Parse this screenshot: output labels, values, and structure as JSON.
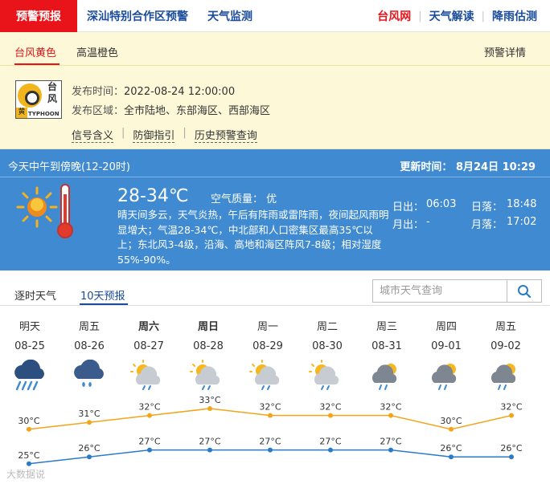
{
  "nav": {
    "active": "预警预报",
    "links": [
      "深汕特别合作区预警",
      "天气监测"
    ],
    "right": [
      "台风网",
      "天气解读",
      "降雨估测"
    ]
  },
  "warning": {
    "tabs": [
      "台风黄色",
      "高温橙色"
    ],
    "detail_link": "预警详情",
    "badge": {
      "title": "台风",
      "level": "黄",
      "en": "TYPHOON"
    },
    "time_label": "发布时间：",
    "time_value": "2022-08-24 12:00:00",
    "area_label": "发布区域：",
    "area_value": "全市陆地、东部海区、西部海区",
    "links": [
      "信号含义",
      "防御指引",
      "历史预警查询"
    ]
  },
  "today": {
    "period": "今天中午到傍晚(12-20时)",
    "update": "更新时间： 8月24日 10:29",
    "temp": "28-34℃",
    "air_quality": "空气质量：  优",
    "description": "晴天间多云，天气炎热，午后有阵雨或雷阵雨，夜间起风雨明显增大；气温28-34℃，中北部和人口密集区最高35℃以上；东北风3-4级，沿海、高地和海区阵风7-8级；相对湿度55%-90%。",
    "sunrise_label": "日出：",
    "sunrise": "06:03",
    "sunset_label": "日落：",
    "sunset": "18:48",
    "moonrise_label": "月出：",
    "moonrise": "-",
    "moonset_label": "月落：",
    "moonset": "17:02"
  },
  "forecast": {
    "tabs": [
      "逐时天气",
      "10天预报"
    ],
    "search_placeholder": "城市天气查询",
    "days": [
      {
        "week": "明天",
        "date": "08-25",
        "icon": "heavy-rain-icon",
        "bold": false
      },
      {
        "week": "周五",
        "date": "08-26",
        "icon": "rain-icon",
        "bold": false
      },
      {
        "week": "周六",
        "date": "08-27",
        "icon": "sun-cloud-rain-icon",
        "bold": true
      },
      {
        "week": "周日",
        "date": "08-28",
        "icon": "sun-cloud-rain-icon",
        "bold": true
      },
      {
        "week": "周一",
        "date": "08-29",
        "icon": "sun-cloud-rain-icon",
        "bold": false
      },
      {
        "week": "周二",
        "date": "08-30",
        "icon": "sun-cloud-rain-icon",
        "bold": false
      },
      {
        "week": "周三",
        "date": "08-31",
        "icon": "sun-cloud-shower-icon",
        "bold": false
      },
      {
        "week": "周四",
        "date": "09-01",
        "icon": "sun-cloud-shower-icon",
        "bold": false
      },
      {
        "week": "周五",
        "date": "09-02",
        "icon": "sun-cloud-shower-icon",
        "bold": false
      }
    ]
  },
  "chart_data": {
    "type": "line",
    "categories": [
      "08-25",
      "08-26",
      "08-27",
      "08-28",
      "08-29",
      "08-30",
      "08-31",
      "09-01",
      "09-02"
    ],
    "series": [
      {
        "values": [
          30,
          31,
          32,
          33,
          32,
          32,
          32,
          30,
          32
        ],
        "color": "#f2a51a"
      },
      {
        "values": [
          25,
          26,
          27,
          27,
          27,
          27,
          27,
          26,
          26
        ],
        "color": "#2a7ac8"
      }
    ],
    "unit": "°C"
  },
  "watermark": "大数据说",
  "colors": {
    "accent_red": "#e8141a",
    "nav_blue": "#1a4c9c",
    "panel_blue": "#3f8ad1",
    "warn_bg": "#fdf8d8"
  }
}
